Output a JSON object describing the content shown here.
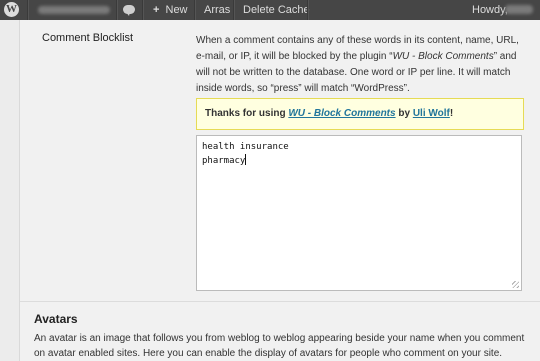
{
  "admin_bar": {
    "new_label": "New",
    "arras_label": "Arras",
    "delete_cache_label": "Delete Cache",
    "howdy_label": "Howdy,"
  },
  "blocklist": {
    "label": "Comment Blocklist",
    "description_part1": "When a comment contains any of these words in its content, name, URL, e-mail, or IP, it will be blocked by the plugin “",
    "description_plugin": "WU - Block Comments",
    "description_part2": "” and will not be written to the database. One word or IP per line. It will match inside words, so “press” will match “WordPress”.",
    "notice_prefix": "Thanks for using ",
    "notice_plugin": "WU - Block Comments",
    "notice_by": " by ",
    "notice_author": "Uli Wolf",
    "notice_suffix": "!",
    "textarea_lines": [
      "health insurance",
      "pharmacy"
    ]
  },
  "avatars": {
    "heading": "Avatars",
    "description": "An avatar is an image that follows you from weblog to weblog appearing beside your name when you comment on avatar enabled sites. Here you can enable the display of avatars for people who comment on your site."
  },
  "colors": {
    "admin_bar": "#464646",
    "notice_bg": "#ffffe0",
    "link": "#21759b"
  },
  "icons": [
    "wordpress-logo-icon",
    "comment-bubble-icon",
    "plus-icon",
    "resize-grip-icon"
  ]
}
